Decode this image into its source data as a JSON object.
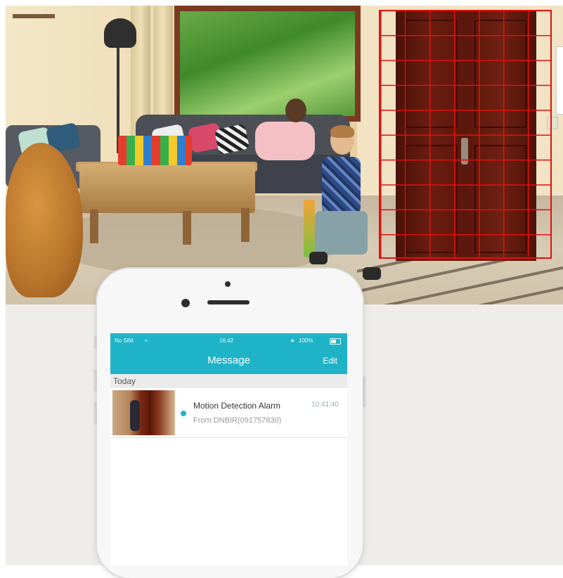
{
  "status_bar": {
    "carrier": "No SIM",
    "time": "16:42",
    "battery": "100%"
  },
  "app": {
    "title": "Message",
    "edit_label": "Edit"
  },
  "section": {
    "label": "Today"
  },
  "messages": [
    {
      "title": "Motion Detection Alarm",
      "time": "10:41:40",
      "subtitle": "From:DNBIR(091757830)"
    }
  ],
  "colors": {
    "accent": "#1fb3c8",
    "motion_grid": "#e01010"
  }
}
